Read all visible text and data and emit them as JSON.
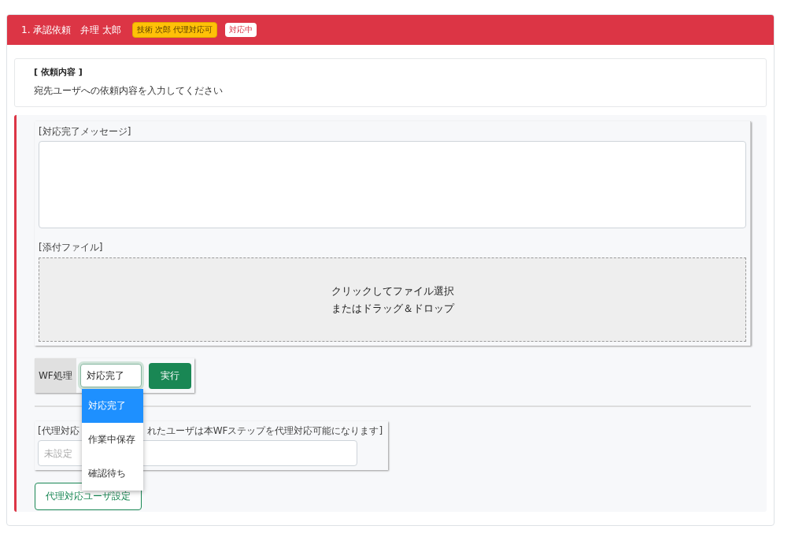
{
  "header": {
    "title": "1. 承認依頼　弁理 太郎",
    "badges": [
      {
        "kind": "warning",
        "label": "技術 次郎 代理対応可"
      },
      {
        "kind": "light",
        "label": "対応中"
      }
    ]
  },
  "request": {
    "heading": "[ 依頼内容 ]",
    "body": "宛先ユーザへの依頼内容を入力してください"
  },
  "message": {
    "label": "[対応完了メッセージ]"
  },
  "attachment": {
    "label": "[添付ファイル]",
    "dropzone_lines": [
      "クリックしてファイル選択",
      "またはドラッグ＆ドロップ"
    ]
  },
  "wf": {
    "label": "WF処理",
    "select_value": "対応完了",
    "execute": "実行",
    "options": [
      {
        "label": "対応完了",
        "selected": true
      },
      {
        "label": "作業中保存",
        "selected": false
      },
      {
        "label": "確認待ち",
        "selected": false
      }
    ]
  },
  "proxy": {
    "label_start": "[代理対応",
    "label_end": "れたユーザは本WFステップを代理対応可能になります]",
    "placeholder": "未設定",
    "button": "代理対応ユーザ設定"
  }
}
